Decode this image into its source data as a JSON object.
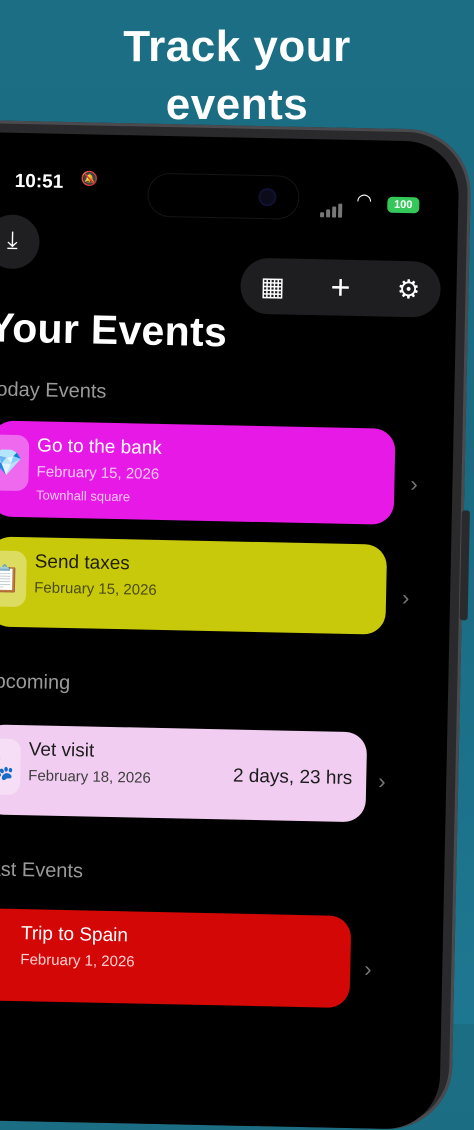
{
  "headline": {
    "line1": "Track your",
    "line2": "events"
  },
  "status": {
    "time": "10:51",
    "battery": "100"
  },
  "page_title": "Your Events",
  "sections": {
    "today": "Today Events",
    "upcoming": "Upcoming",
    "past": "Past Events"
  },
  "today_events": [
    {
      "title": "Go to the bank",
      "date": "February 15, 2026",
      "location": "Townhall square",
      "color": "#e619e6",
      "icon": "diamond-icon"
    },
    {
      "title": "Send taxes",
      "date": "February 15, 2026",
      "color": "#c9c90b",
      "icon": "checklist-icon"
    }
  ],
  "upcoming_events": [
    {
      "title": "Vet visit",
      "date": "February 18, 2026",
      "remaining": "2 days, 23 hrs",
      "color": "#f2cdf2",
      "icon": "pet-icon"
    }
  ],
  "past_events": [
    {
      "title": "Trip to Spain",
      "date": "February 1, 2026",
      "color": "#d40707"
    }
  ],
  "icons": {
    "back": "share-import-icon",
    "calendar": "calendar-icon",
    "add": "plus-icon",
    "settings": "gear-icon"
  }
}
